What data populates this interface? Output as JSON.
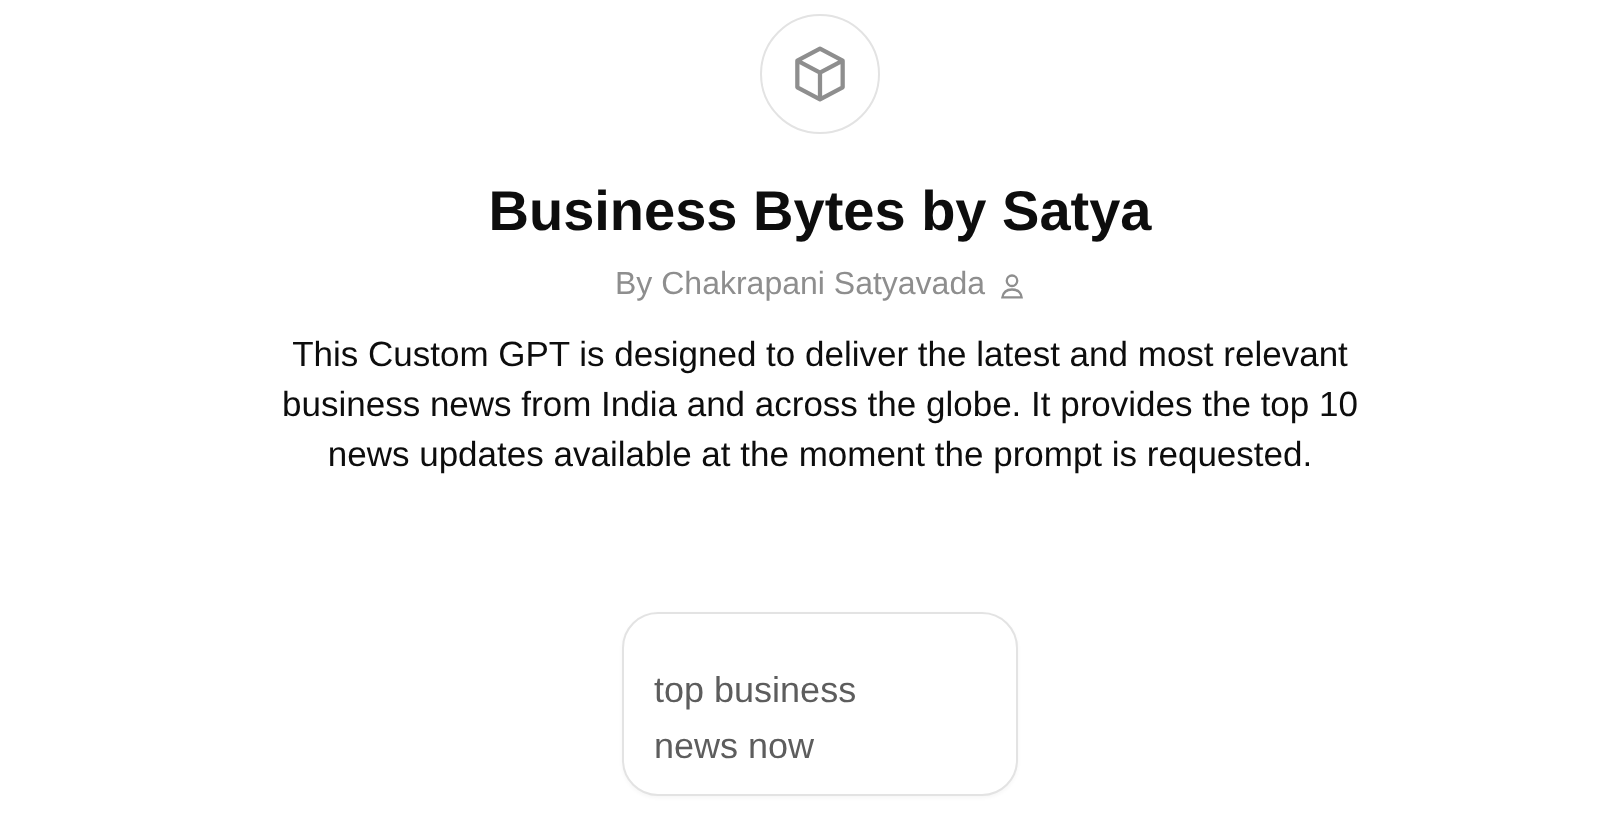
{
  "title": "Business Bytes by Satya",
  "author": "By Chakrapani Satyavada",
  "description": "This Custom GPT is designed to deliver the latest and most relevant business news from India and across the globe. It provides the top 10 news updates available at the moment the prompt is requested.",
  "starters": [
    "top business news now"
  ]
}
